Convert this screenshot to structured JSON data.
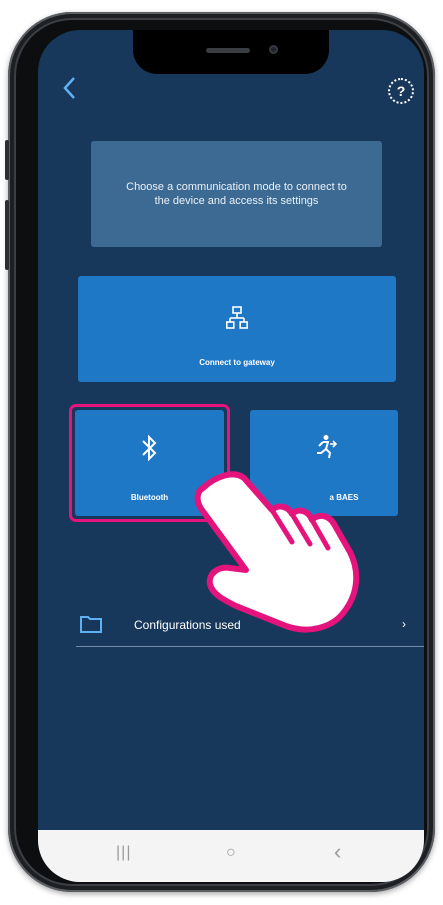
{
  "header": {
    "back_icon": "chevron-left-icon",
    "help_label": "?"
  },
  "info_text": "Choose a communication mode to connect to the device and access its settings",
  "tiles": {
    "gateway": {
      "label": "Connect to gateway",
      "icon": "network-icon"
    },
    "bluetooth": {
      "label": "Bluetooth",
      "icon": "bluetooth-icon"
    },
    "baes": {
      "label": "a BAES",
      "icon": "running-person-icon"
    }
  },
  "configurations": {
    "label": "Configurations used",
    "icon": "folder-icon",
    "chevron": "›"
  },
  "navbar": {
    "recent": "|||",
    "home": "○",
    "back": "‹"
  },
  "colors": {
    "background": "#17385a",
    "tile": "#1f78c6",
    "info_card": "#3c6a93",
    "highlight": "#e4147c",
    "accent": "#5fb0f3"
  }
}
